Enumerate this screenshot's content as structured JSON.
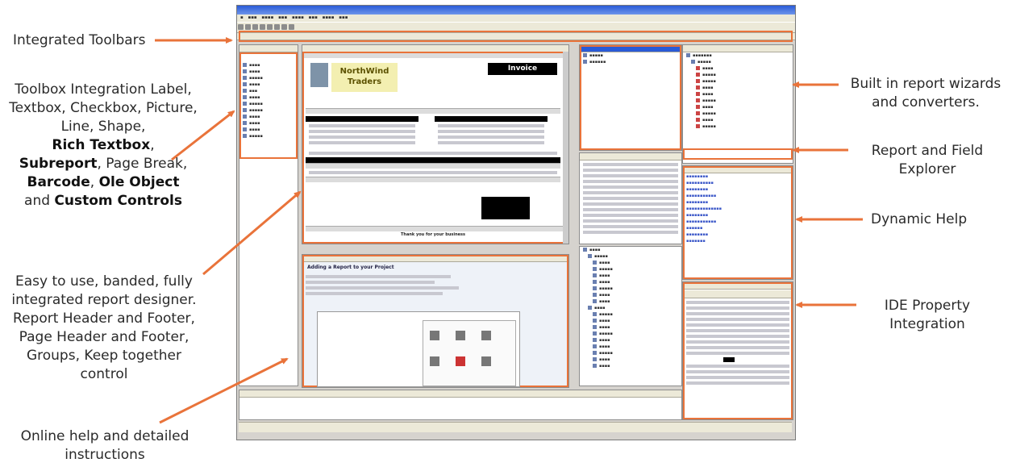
{
  "callouts": {
    "toolbars": "Integrated Toolbars",
    "toolbox_intro": "Toolbox Integration Label, Textbox, Checkbox, Picture, Line, Shape,",
    "rich_textbox": "Rich Textbox",
    "subreport": "Subreport",
    "page_break": ", Page Break,",
    "barcode": "Barcode",
    "comma": ",",
    "ole_object": "Ole Object",
    "and": "and",
    "custom_controls": "Custom Controls",
    "designer": "Easy to use, banded, fully integrated report designer. Report Header and Footer, Page Header and Footer, Groups, Keep together control",
    "online_help": "Online help and detailed instructions",
    "wizards": "Built in report wizards and converters.",
    "explorer": "Report and Field Explorer",
    "dynamic_help": "Dynamic Help",
    "property": "IDE Property Integration"
  },
  "ide": {
    "report": {
      "company_name": "NorthWind Traders",
      "invoice_title": "Invoice",
      "footer_text": "Thank you for your business"
    },
    "help_heading": "Adding a Report to your Project"
  },
  "colors": {
    "callout_arrow": "#e9733a",
    "pane_border": "#e9733a"
  }
}
